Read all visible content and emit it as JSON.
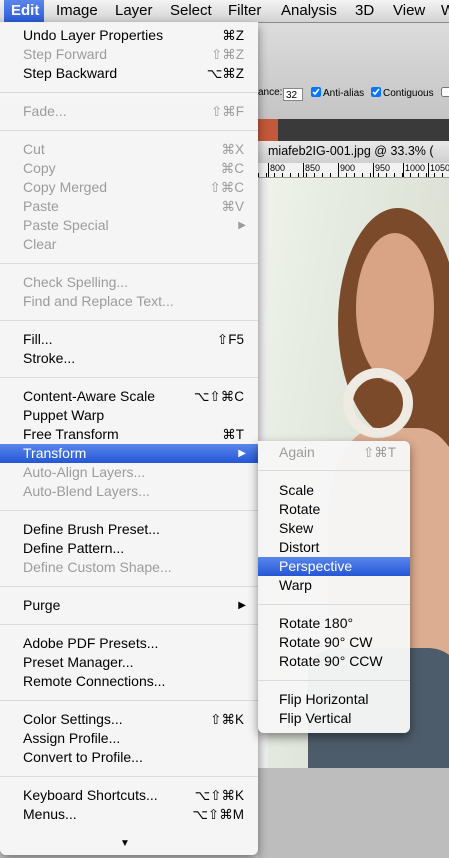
{
  "menubar": {
    "items": [
      "Edit",
      "Image",
      "Layer",
      "Select",
      "Filter",
      "Analysis",
      "3D",
      "View",
      "W"
    ],
    "active": "Edit"
  },
  "options_bar": {
    "tolerance_label": "ance:",
    "tolerance_value": "32",
    "anti_alias": "Anti-alias",
    "contiguous": "Contiguous"
  },
  "document": {
    "title": "miafeb2IG-001.jpg @ 33.3% (",
    "ruler_labels": [
      "800",
      "850",
      "900",
      "950",
      "1000",
      "1050",
      "110"
    ]
  },
  "edit_menu": {
    "items": [
      {
        "label": "Undo Layer Properties",
        "shortcut": "⌘Z",
        "enabled": true
      },
      {
        "label": "Step Forward",
        "shortcut": "⇧⌘Z",
        "enabled": false
      },
      {
        "label": "Step Backward",
        "shortcut": "⌥⌘Z",
        "enabled": true
      },
      {
        "label": "Fade...",
        "shortcut": "⇧⌘F",
        "enabled": false
      },
      {
        "label": "Cut",
        "shortcut": "⌘X",
        "enabled": false
      },
      {
        "label": "Copy",
        "shortcut": "⌘C",
        "enabled": false
      },
      {
        "label": "Copy Merged",
        "shortcut": "⇧⌘C",
        "enabled": false
      },
      {
        "label": "Paste",
        "shortcut": "⌘V",
        "enabled": false
      },
      {
        "label": "Paste Special",
        "shortcut": "",
        "enabled": false,
        "submenu": true
      },
      {
        "label": "Clear",
        "shortcut": "",
        "enabled": false
      },
      {
        "label": "Check Spelling...",
        "shortcut": "",
        "enabled": false
      },
      {
        "label": "Find and Replace Text...",
        "shortcut": "",
        "enabled": false
      },
      {
        "label": "Fill...",
        "shortcut": "⇧F5",
        "enabled": true
      },
      {
        "label": "Stroke...",
        "shortcut": "",
        "enabled": true
      },
      {
        "label": "Content-Aware Scale",
        "shortcut": "⌥⇧⌘C",
        "enabled": true
      },
      {
        "label": "Puppet Warp",
        "shortcut": "",
        "enabled": true
      },
      {
        "label": "Free Transform",
        "shortcut": "⌘T",
        "enabled": true
      },
      {
        "label": "Transform",
        "shortcut": "",
        "enabled": true,
        "submenu": true,
        "highlighted": true
      },
      {
        "label": "Auto-Align Layers...",
        "shortcut": "",
        "enabled": false
      },
      {
        "label": "Auto-Blend Layers...",
        "shortcut": "",
        "enabled": false
      },
      {
        "label": "Define Brush Preset...",
        "shortcut": "",
        "enabled": true
      },
      {
        "label": "Define Pattern...",
        "shortcut": "",
        "enabled": true
      },
      {
        "label": "Define Custom Shape...",
        "shortcut": "",
        "enabled": false
      },
      {
        "label": "Purge",
        "shortcut": "",
        "enabled": true,
        "submenu": true
      },
      {
        "label": "Adobe PDF Presets...",
        "shortcut": "",
        "enabled": true
      },
      {
        "label": "Preset Manager...",
        "shortcut": "",
        "enabled": true
      },
      {
        "label": "Remote Connections...",
        "shortcut": "",
        "enabled": true
      },
      {
        "label": "Color Settings...",
        "shortcut": "⇧⌘K",
        "enabled": true
      },
      {
        "label": "Assign Profile...",
        "shortcut": "",
        "enabled": true
      },
      {
        "label": "Convert to Profile...",
        "shortcut": "",
        "enabled": true
      },
      {
        "label": "Keyboard Shortcuts...",
        "shortcut": "⌥⇧⌘K",
        "enabled": true
      },
      {
        "label": "Menus...",
        "shortcut": "⌥⇧⌘M",
        "enabled": true
      }
    ],
    "submenu_arrow": "▶",
    "scroll_arrow": "▼"
  },
  "transform_submenu": {
    "items": [
      {
        "label": "Again",
        "shortcut": "⇧⌘T",
        "enabled": false
      },
      {
        "label": "Scale",
        "enabled": true
      },
      {
        "label": "Rotate",
        "enabled": true
      },
      {
        "label": "Skew",
        "enabled": true
      },
      {
        "label": "Distort",
        "enabled": true
      },
      {
        "label": "Perspective",
        "enabled": true,
        "highlighted": true
      },
      {
        "label": "Warp",
        "enabled": true
      },
      {
        "label": "Rotate 180°",
        "enabled": true
      },
      {
        "label": "Rotate 90° CW",
        "enabled": true
      },
      {
        "label": "Rotate 90° CCW",
        "enabled": true
      },
      {
        "label": "Flip Horizontal",
        "enabled": true
      },
      {
        "label": "Flip Vertical",
        "enabled": true
      }
    ]
  },
  "colors": {
    "highlight": "#2f62dc",
    "disabled_text": "#9c9c9c"
  }
}
